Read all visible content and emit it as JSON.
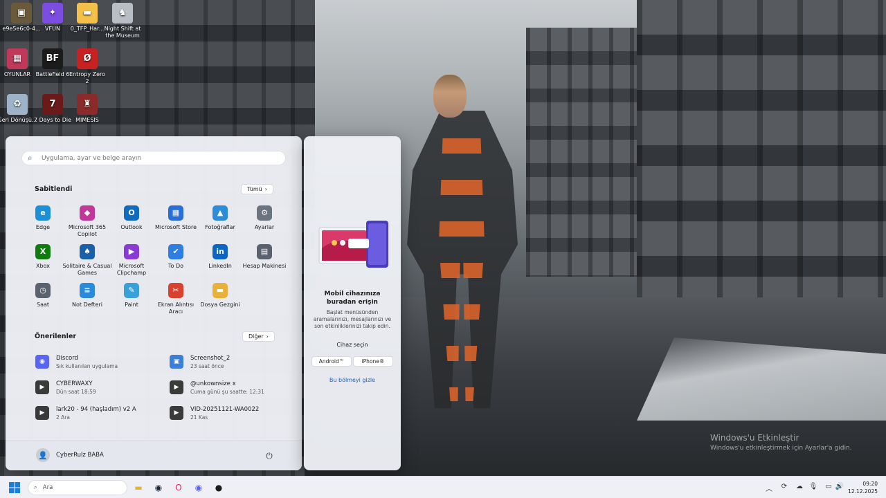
{
  "desktop": {
    "icons": [
      {
        "label": "e9e5e6c0-4...",
        "icon": "game-icon",
        "color": "#6b5a3a",
        "glyph": "▣"
      },
      {
        "label": "VFUN",
        "icon": "vfun-icon",
        "color": "#7b4de0",
        "glyph": "✦"
      },
      {
        "label": "0_TFP_Har...",
        "icon": "folder-icon",
        "color": "#f3c04a",
        "glyph": "▬"
      },
      {
        "label": "Night Shift at the Museum",
        "icon": "game-icon",
        "color": "#b9bdc4",
        "glyph": "♞"
      },
      {
        "label": "OYUNLAR",
        "icon": "winrar-icon",
        "color": "#c0395a",
        "glyph": "▦"
      },
      {
        "label": "Battlefield 6",
        "icon": "battlefield-icon",
        "color": "#1b1b1b",
        "glyph": "BF"
      },
      {
        "label": "Entropy Zero 2",
        "icon": "entropy-icon",
        "color": "#c82121",
        "glyph": "Ø"
      },
      {
        "label": "Geri Dönüşü...",
        "icon": "recycle-bin-icon",
        "color": "#9fb3c8",
        "glyph": "♻"
      },
      {
        "label": "7 Days to Die",
        "icon": "7days-icon",
        "color": "#6b1a1a",
        "glyph": "7"
      },
      {
        "label": "MIMESIS",
        "icon": "mimesis-icon",
        "color": "#8a2a2a",
        "glyph": "♜"
      }
    ]
  },
  "start_menu": {
    "search_placeholder": "Uygulama, ayar ve belge arayın",
    "pinned_title": "Sabitlendi",
    "all_button": "Tümü",
    "pinned": [
      {
        "label": "Edge",
        "icon": "edge-icon",
        "color": "#1b8fd8",
        "glyph": "e"
      },
      {
        "label": "Microsoft 365 Copilot",
        "icon": "m365-copilot-icon",
        "color": "#c0399a",
        "glyph": "◆"
      },
      {
        "label": "Outlook",
        "icon": "outlook-icon",
        "color": "#0f6cbd",
        "glyph": "O"
      },
      {
        "label": "Microsoft Store",
        "icon": "store-icon",
        "color": "#2a6fd6",
        "glyph": "▦"
      },
      {
        "label": "Fotoğraflar",
        "icon": "photos-icon",
        "color": "#2d8cd9",
        "glyph": "▲"
      },
      {
        "label": "Ayarlar",
        "icon": "settings-icon",
        "color": "#6c7480",
        "glyph": "⚙"
      },
      {
        "label": "Xbox",
        "icon": "xbox-icon",
        "color": "#107c10",
        "glyph": "X"
      },
      {
        "label": "Solitaire & Casual Games",
        "icon": "solitaire-icon",
        "color": "#1b5fa8",
        "glyph": "♠"
      },
      {
        "label": "Microsoft Clipchamp",
        "icon": "clipchamp-icon",
        "color": "#8a3bd1",
        "glyph": "▶"
      },
      {
        "label": "To Do",
        "icon": "todo-icon",
        "color": "#2f7de1",
        "glyph": "✔"
      },
      {
        "label": "LinkedIn",
        "icon": "linkedin-icon",
        "color": "#0a66c2",
        "glyph": "in"
      },
      {
        "label": "Hesap Makinesi",
        "icon": "calculator-icon",
        "color": "#5a6270",
        "glyph": "▤"
      },
      {
        "label": "Saat",
        "icon": "clock-icon",
        "color": "#5a6270",
        "glyph": "◷"
      },
      {
        "label": "Not Defteri",
        "icon": "notepad-icon",
        "color": "#2b8ad9",
        "glyph": "≡"
      },
      {
        "label": "Paint",
        "icon": "paint-icon",
        "color": "#3aa0d8",
        "glyph": "✎"
      },
      {
        "label": "Ekran Alıntısı Aracı",
        "icon": "snipping-tool-icon",
        "color": "#d8412f",
        "glyph": "✂"
      },
      {
        "label": "Dosya Gezgini",
        "icon": "file-explorer-icon",
        "color": "#e8b23a",
        "glyph": "▬"
      }
    ],
    "recommended_title": "Önerilenler",
    "more_button": "Diğer",
    "recommended": [
      {
        "name": "Discord",
        "sub": "Sık kullanılan uygulama",
        "icon": "discord-icon",
        "color": "#5865f2",
        "glyph": "◉"
      },
      {
        "name": "Screenshot_2",
        "sub": "23 saat önce",
        "icon": "image-file-icon",
        "color": "#3b7fd6",
        "glyph": "▣"
      },
      {
        "name": "CYBERWAXY",
        "sub": "Dün saat 18:59",
        "icon": "video-file-icon",
        "color": "#3a3a3a",
        "glyph": "▶"
      },
      {
        "name": "@unkownsize x",
        "sub": "Cuma günü şu saatte: 12:31",
        "icon": "video-file-icon",
        "color": "#3a3a3a",
        "glyph": "▶"
      },
      {
        "name": "lark20 - 94 (haşladım) v2 A",
        "sub": "2 Ara",
        "icon": "video-file-icon",
        "color": "#3a3a3a",
        "glyph": "▶"
      },
      {
        "name": "VID-20251121-WA0022",
        "sub": "21 Kas",
        "icon": "video-file-icon",
        "color": "#3a3a3a",
        "glyph": "▶"
      }
    ],
    "user_name": "CyberRulz BABA"
  },
  "phone_panel": {
    "title": "Mobil cihazınıza buradan erişin",
    "description": "Başlat menüsünden aramalarınızı, mesajlarınızı ve son etkinliklerinizi takip edin.",
    "choose_label": "Cihaz seçin",
    "android_button": "Android™",
    "iphone_button": "iPhone®",
    "hide_link": "Bu bölmeyi gizle"
  },
  "watermark": {
    "title": "Windows'u Etkinleştir",
    "subtitle": "Windows'u etkinleştirmek için Ayarlar'a gidin."
  },
  "taskbar": {
    "search_placeholder": "Ara",
    "apps": [
      {
        "icon": "file-explorer-icon",
        "color": "#e8b23a",
        "glyph": "▬"
      },
      {
        "icon": "steam-icon",
        "color": "#1b2838",
        "glyph": "◉"
      },
      {
        "icon": "opera-icon",
        "color": "#e0245e",
        "glyph": "O"
      },
      {
        "icon": "discord-icon",
        "color": "#5865f2",
        "glyph": "◉"
      },
      {
        "icon": "github-icon",
        "color": "#1b1b1b",
        "glyph": "●"
      }
    ],
    "time": "09:20",
    "date": "12.12.2025"
  }
}
